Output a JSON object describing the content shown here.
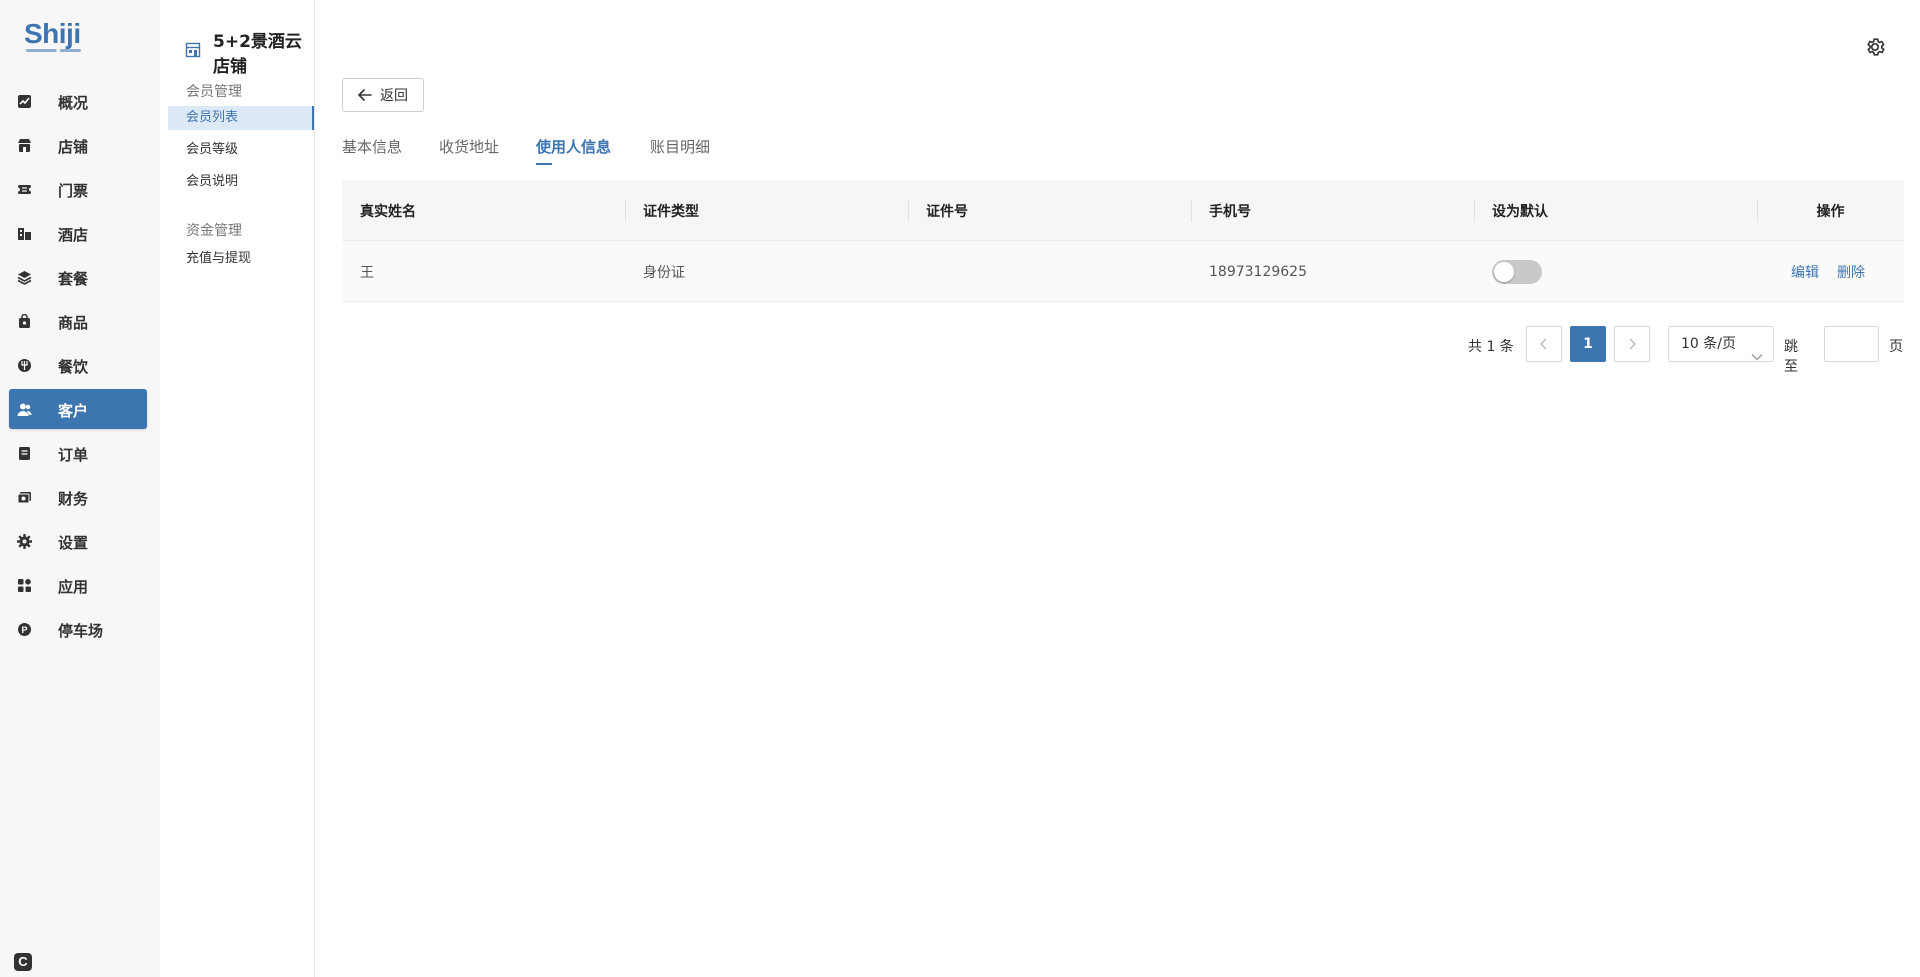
{
  "logo": "Shiji",
  "store_title": "5+2景酒云店铺",
  "nav": [
    {
      "label": "概况",
      "icon": "chart-icon",
      "active": false
    },
    {
      "label": "店铺",
      "icon": "store-icon",
      "active": false
    },
    {
      "label": "门票",
      "icon": "ticket-icon",
      "active": false
    },
    {
      "label": "酒店",
      "icon": "hotel-icon",
      "active": false
    },
    {
      "label": "套餐",
      "icon": "layers-icon",
      "active": false
    },
    {
      "label": "商品",
      "icon": "bag-icon",
      "active": false
    },
    {
      "label": "餐饮",
      "icon": "dining-icon",
      "active": false
    },
    {
      "label": "客户",
      "icon": "users-icon",
      "active": true
    },
    {
      "label": "订单",
      "icon": "order-icon",
      "active": false
    },
    {
      "label": "财务",
      "icon": "wallet-icon",
      "active": false
    },
    {
      "label": "设置",
      "icon": "gear-icon",
      "active": false
    },
    {
      "label": "应用",
      "icon": "apps-icon",
      "active": false
    },
    {
      "label": "停车场",
      "icon": "parking-icon",
      "active": false
    }
  ],
  "nav_bottom_icon": "C",
  "subnav": {
    "groups": [
      {
        "title": "会员管理",
        "items": [
          {
            "label": "会员列表",
            "active": true
          },
          {
            "label": "会员等级",
            "active": false
          },
          {
            "label": "会员说明",
            "active": false
          }
        ]
      },
      {
        "title": "资金管理",
        "items": [
          {
            "label": "充值与提现",
            "active": false
          }
        ]
      }
    ]
  },
  "back_label": "返回",
  "tabs": [
    {
      "label": "基本信息",
      "active": false
    },
    {
      "label": "收货地址",
      "active": false
    },
    {
      "label": "使用人信息",
      "active": true
    },
    {
      "label": "账目明细",
      "active": false
    }
  ],
  "table": {
    "columns": [
      "真实姓名",
      "证件类型",
      "证件号",
      "手机号",
      "设为默认",
      "操作"
    ],
    "rows": [
      {
        "name": "王",
        "id_type": "身份证",
        "id_number": "",
        "phone": "18973129625",
        "is_default": false,
        "actions": [
          "编辑",
          "删除"
        ]
      }
    ]
  },
  "pagination": {
    "total": "共 1 条",
    "current_page": "1",
    "page_size": "10 条/页",
    "jump_label": "跳至",
    "jump_value": "",
    "jump_suffix": "页"
  },
  "colors": {
    "accent": "#3d75b0",
    "nav_bg": "#f7f7f7",
    "header_bg": "#f5f6f7"
  }
}
